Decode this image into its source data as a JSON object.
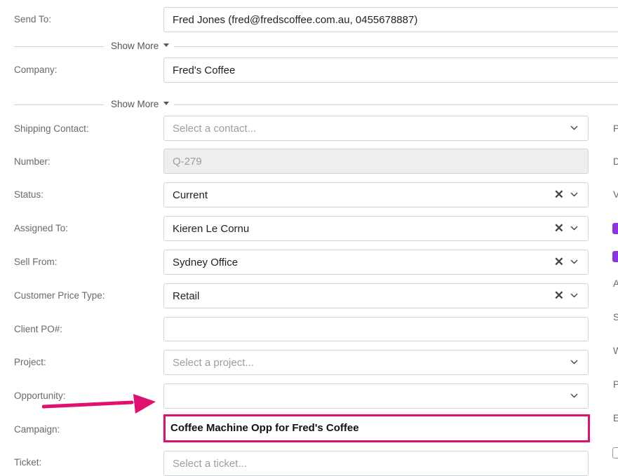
{
  "send_to": {
    "label": "Send To:",
    "value": "Fred Jones (fred@fredscoffee.com.au, 0455678887)"
  },
  "show_more_1": "Show More",
  "company": {
    "label": "Company:",
    "value": "Fred's Coffee"
  },
  "show_more_2": "Show More",
  "shipping_contact": {
    "label": "Shipping Contact:",
    "placeholder": "Select a contact..."
  },
  "number": {
    "label": "Number:",
    "value": "Q-279"
  },
  "status": {
    "label": "Status:",
    "value": "Current"
  },
  "assigned_to": {
    "label": "Assigned To:",
    "value": "Kieren Le Cornu"
  },
  "sell_from": {
    "label": "Sell From:",
    "value": "Sydney Office"
  },
  "customer_price_type": {
    "label": "Customer Price Type:",
    "value": "Retail"
  },
  "client_po": {
    "label": "Client PO#:",
    "value": ""
  },
  "project": {
    "label": "Project:",
    "placeholder": "Select a project..."
  },
  "opportunity": {
    "label": "Opportunity:",
    "value": ""
  },
  "campaign": {
    "label": "Campaign:",
    "value": "Coffee Machine Opp for Fred's Coffee"
  },
  "ticket": {
    "label": "Ticket:",
    "placeholder": "Select a ticket..."
  },
  "right_column": {
    "labels": [
      "P",
      "D",
      "V",
      "A",
      "S",
      "W",
      "P",
      "E"
    ]
  },
  "colors": {
    "accent_checkbox": "#8a35e0",
    "highlight": "#e0116e"
  }
}
